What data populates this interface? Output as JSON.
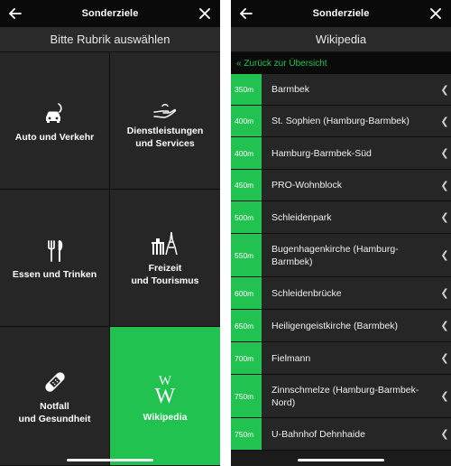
{
  "left": {
    "header": {
      "title": "Sonderziele"
    },
    "subheader": "Bitte Rubrik auswählen",
    "categories": [
      {
        "label": "Auto und Verkehr",
        "icon": "car-icon"
      },
      {
        "label": "Dienstleistungen\nund Services",
        "icon": "service-hand-icon"
      },
      {
        "label": "Essen und Trinken",
        "icon": "cutlery-icon"
      },
      {
        "label": "Freizeit\nund Tourismus",
        "icon": "landmarks-icon"
      },
      {
        "label": "Notfall\nund Gesundheit",
        "icon": "bandage-icon"
      },
      {
        "label": "Wikipedia",
        "icon": "wikipedia-icon",
        "active": true
      }
    ]
  },
  "right": {
    "header": {
      "title": "Sonderziele"
    },
    "subheader": "Wikipedia",
    "back_link": "« Zurück zur Übersicht",
    "items": [
      {
        "distance": "350m",
        "name": "Barmbek"
      },
      {
        "distance": "400m",
        "name": "St. Sophien (Hamburg-Barmbek)"
      },
      {
        "distance": "400m",
        "name": "Hamburg-Barmbek-Süd"
      },
      {
        "distance": "450m",
        "name": "PRO-Wohnblock"
      },
      {
        "distance": "500m",
        "name": "Schleidenpark"
      },
      {
        "distance": "550m",
        "name": "Bugenhagenkirche (Hamburg-Barmbek)"
      },
      {
        "distance": "600m",
        "name": "Schleidenbrücke"
      },
      {
        "distance": "650m",
        "name": "Heiligengeistkirche (Barmbek)"
      },
      {
        "distance": "700m",
        "name": "Fielmann"
      },
      {
        "distance": "750m",
        "name": "Zinnschmelze (Hamburg-Barmbek-Nord)"
      },
      {
        "distance": "750m",
        "name": "U-Bahnhof Dehnhaide"
      }
    ]
  },
  "colors": {
    "accent": "#21c24f",
    "background": "#1b1b1b",
    "tile": "#262626",
    "topbar": "#0a0a0a"
  }
}
